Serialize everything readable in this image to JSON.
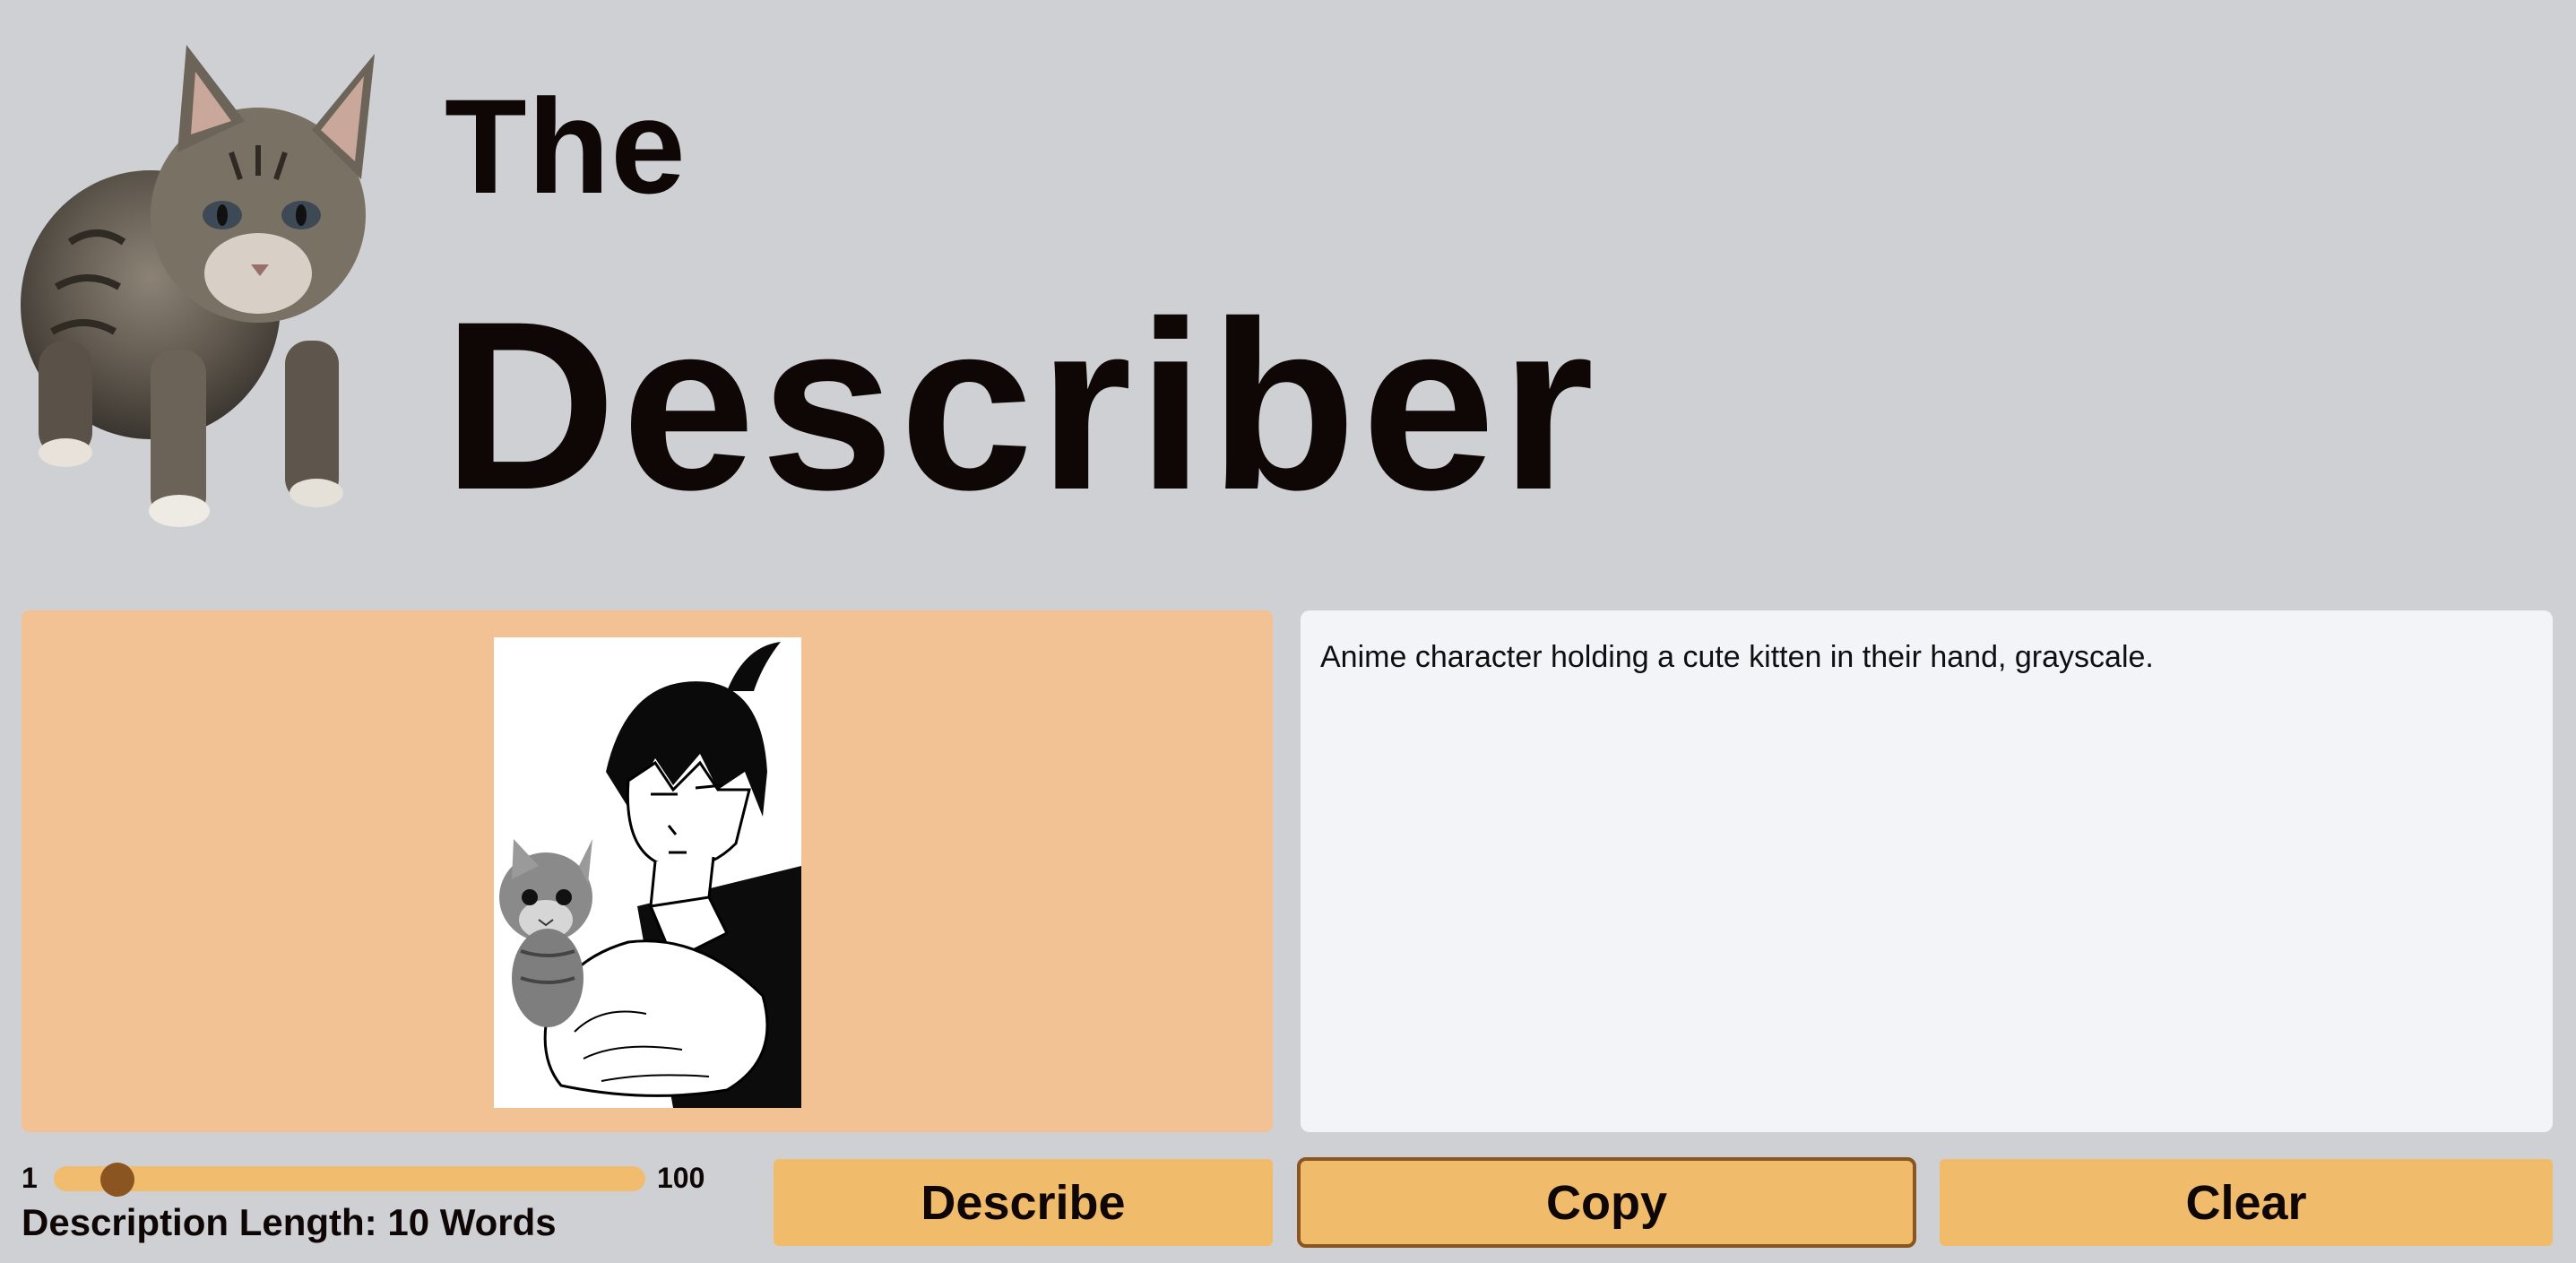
{
  "header": {
    "title_line1": "The",
    "title_line2": "Describer"
  },
  "icons": {
    "logo": "tabby-cat-logo",
    "uploaded_image": "anime-character-holding-kitten-image"
  },
  "output": {
    "description": "Anime character holding a cute kitten in their hand, grayscale."
  },
  "slider": {
    "min_label": "1",
    "max_label": "100",
    "value": 10,
    "min": 1,
    "max": 100
  },
  "length_label": "Description Length: 10 Words",
  "buttons": {
    "describe": "Describe",
    "copy": "Copy",
    "clear": "Clear"
  },
  "colors": {
    "background": "#cfd0d3",
    "image_panel": "#f3c294",
    "output_panel": "#f3f4f8",
    "button": "#f0bc6b",
    "accent": "#8a5520",
    "text": "#0f0606"
  }
}
